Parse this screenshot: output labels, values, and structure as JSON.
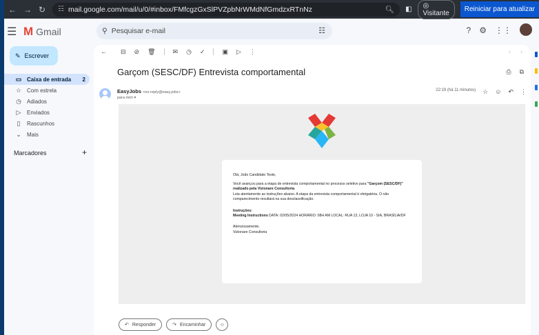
{
  "browser": {
    "url": "mail.google.com/mail/u/0/#inbox/FMfcgzGxSlPVZpbNrWMdNfGmdzxRTnNz",
    "visitor_label": "Visitante",
    "restart_label": "Reiniciar para atualizar"
  },
  "header": {
    "app_name": "Gmail",
    "search_placeholder": "Pesquisar e-mail"
  },
  "sidebar": {
    "compose_label": "Escrever",
    "items": [
      {
        "label": "Caixa de entrada",
        "count": "2",
        "icon": "inbox-icon"
      },
      {
        "label": "Com estrela",
        "count": "",
        "icon": "star-icon"
      },
      {
        "label": "Adiados",
        "count": "",
        "icon": "clock-icon"
      },
      {
        "label": "Enviados",
        "count": "",
        "icon": "send-icon"
      },
      {
        "label": "Rascunhos",
        "count": "",
        "icon": "draft-icon"
      },
      {
        "label": "Mais",
        "count": "",
        "icon": "chevron-down-icon"
      }
    ],
    "labels_title": "Marcadores"
  },
  "email": {
    "subject": "Garçom (SESC/DF) Entrevista comportamental",
    "sender_name": "EasyJobs",
    "sender_email": "<no-reply@easy.jobs>",
    "to_line": "para mim",
    "timestamp": "22:19 (há 11 minutos)",
    "greeting": "Olá, João Candidato Teste,",
    "para1_pre": "Você avançou para a etapa de entrevista comportamental no processo seletivo para ",
    "para1_bold": "\"Garçom (SESC/DF)\" realizado pela Vizionare Consultoria",
    "para1_post": ".",
    "para2": "Leia atentamente as instruções abaixo. A etapa da entrevista comportamental é obrigatória. O não comparecimento resultará na sua desclassificação.",
    "instructions_title": "Instruções:",
    "instructions_label": "Meeting Instructions",
    "instructions_text": " DATA: 02/05/2024 HORÁRIO: 08H AM LOCAL: RUA 13, LOJA 10 - SIA, BRASÍLIA/DF",
    "signoff": "Atenciosamente,",
    "company": "Vizionare Consultoria"
  },
  "actions": {
    "reply_label": "Responder",
    "forward_label": "Encaminhar"
  },
  "colors": {
    "compose_bg": "#c2e7ff",
    "active_nav": "#d3e3fd",
    "logo_red": "#e53935",
    "logo_green": "#7cb342",
    "logo_blue": "#29b6f6"
  }
}
